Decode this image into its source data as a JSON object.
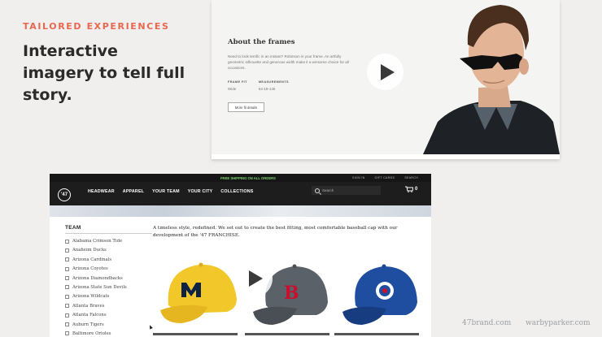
{
  "slide": {
    "eyebrow": "TAILORED EXPERIENCES",
    "headline": "Interactive imagery to tell full story."
  },
  "warby": {
    "title": "About the frames",
    "description": "Need to look terrific in an instant? Robinson is your frame. An artfully geometric silhouette and generous width make it a winsome choice for all occasions.",
    "specs": [
      {
        "label": "FRAME FIT",
        "value": "Wide"
      },
      {
        "label": "MEASUREMENTS",
        "value": "54-19-145"
      }
    ],
    "button_label": "More fit details"
  },
  "fortyseven": {
    "shipping_banner": "FREE SHIPPING ON ALL ORDERS",
    "utility_links": [
      "SIGN IN",
      "GIFT CARDS",
      "SEARCH"
    ],
    "logo": "'47",
    "nav": [
      "HEADWEAR",
      "APPAREL",
      "YOUR TEAM",
      "YOUR CITY",
      "COLLECTIONS"
    ],
    "search_placeholder": "Search",
    "cart_count": "0",
    "sidebar_title": "TEAM",
    "teams": [
      "Alabama Crimson Tide",
      "Anaheim Ducks",
      "Arizona Cardinals",
      "Arizona Coyotes",
      "Arizona Diamondbacks",
      "Arizona State Sun Devils",
      "Arizona Wildcats",
      "Atlanta Braves",
      "Atlanta Falcons",
      "Auburn Tigers",
      "Baltimore Orioles"
    ],
    "intro": "A timeless style, redefined. We set out to create the best fitting, most comfortable baseball cap with our development of the '47 FRANCHISE.",
    "caps": [
      {
        "letter": "M",
        "color": "#f2c72a",
        "logo_color": "#0e2344"
      },
      {
        "letter": "B",
        "color": "#5b6169",
        "logo_color": "#c8102e"
      },
      {
        "letter": "TB",
        "color": "#1f4ea0",
        "logo_color": "#ffffff"
      }
    ]
  },
  "footer": {
    "left": "47brand.com",
    "right": "warbyparker.com"
  },
  "colors": {
    "accent": "#e8674f",
    "background": "#f1efed"
  }
}
